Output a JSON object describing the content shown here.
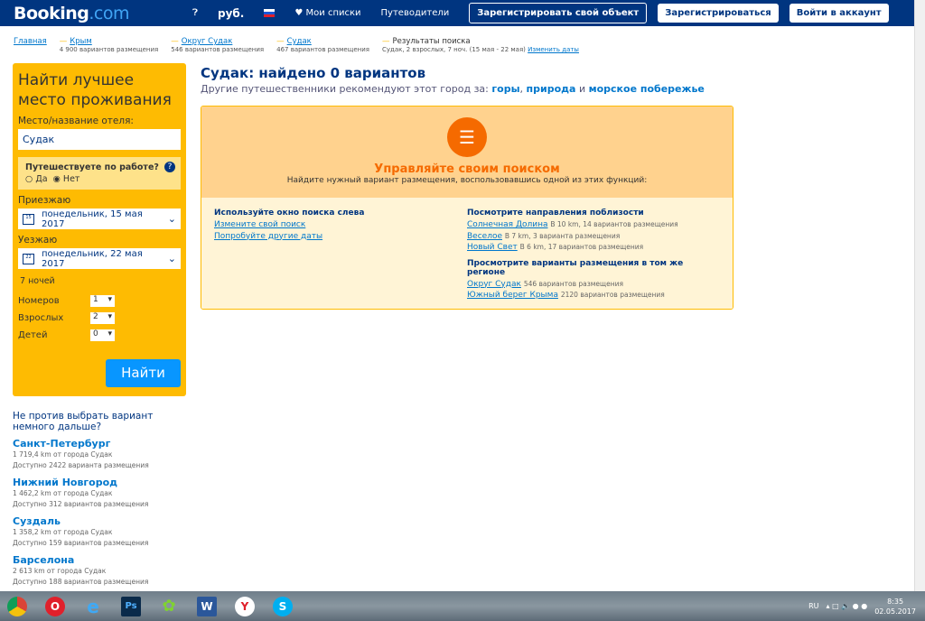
{
  "header": {
    "logo_main": "Booking",
    "logo_tld": ".com",
    "currency": "руб.",
    "my_lists": "Мои списки",
    "guides": "Путеводители",
    "register_property": "Зарегистрировать свой объект",
    "register": "Зарегистрироваться",
    "sign_in": "Войти в аккаунт"
  },
  "breadcrumbs": [
    {
      "label": "Главная",
      "sub": ""
    },
    {
      "label": "Крым",
      "sub": "4 900 вариантов размещения"
    },
    {
      "label": "Округ Судак",
      "sub": "546 вариантов размещения"
    },
    {
      "label": "Судак",
      "sub": "467 вариантов размещения"
    },
    {
      "label": "Результаты поиска",
      "sub": "Судак, 2 взрослых, 7 ноч. (15 мая - 22 мая)",
      "link": "Изменить даты"
    }
  ],
  "search": {
    "title": "Найти лучшее место проживания",
    "dest_label": "Место/название отеля:",
    "dest_value": "Судак",
    "business_q": "Путешествуете по работе?",
    "yes": "Да",
    "no": "Нет",
    "business_selected": "Нет",
    "checkin_label": "Приезжаю",
    "checkin_day": "15",
    "checkin": "понедельник, 15 мая 2017",
    "checkout_label": "Уезжаю",
    "checkout_day": "22",
    "checkout": "понедельник, 22 мая 2017",
    "nights": "7 ночей",
    "rooms_label": "Номеров",
    "rooms": "1",
    "adults_label": "Взрослых",
    "adults": "2",
    "children_label": "Детей",
    "children": "0",
    "submit": "Найти"
  },
  "alternatives": {
    "title": "Не против выбрать вариант немного дальше?",
    "items": [
      {
        "name": "Санкт-Петербург",
        "dist": "1 719,4 km от города Судак",
        "avail": "Доступно 2422 варианта размещения"
      },
      {
        "name": "Нижний Новгород",
        "dist": "1 462,2 km от города Судак",
        "avail": "Доступно 312 вариантов размещения"
      },
      {
        "name": "Суздаль",
        "dist": "1 358,2 km от города Судак",
        "avail": "Доступно 159 вариантов размещения"
      },
      {
        "name": "Барселона",
        "dist": "2 613 km от города Судак",
        "avail": "Доступно 188 вариантов размещения"
      }
    ]
  },
  "main": {
    "title": "Судак: найдено 0 вариантов",
    "rec_prefix": "Другие путешественники рекомендуют этот город за:",
    "rec1": "горы",
    "rec2": "природа",
    "rec_and": "и",
    "rec3": "морское побережье",
    "manage_title": "Управляйте своим поиском",
    "manage_sub": "Найдите нужный вариант размещения, воспользовавшись одной из этих функций:",
    "left_title": "Используйте окно поиска слева",
    "left_links": [
      "Измените свой поиск",
      "Попробуйте другие даты"
    ],
    "nearby_title": "Посмотрите направления поблизости",
    "nearby": [
      {
        "name": "Солнечная Долина",
        "info": "В 10 km, 14 вариантов размещения"
      },
      {
        "name": "Веселое",
        "info": "В 7 km, 3 варианта размещения"
      },
      {
        "name": "Новый Свет",
        "info": "В 6 km, 17 вариантов размещения"
      }
    ],
    "region_title": "Просмотрите варианты размещения в том же регионе",
    "region": [
      {
        "name": "Округ Судак",
        "info": "546 вариантов размещения"
      },
      {
        "name": "Южный берег Крыма",
        "info": "2120 вариантов размещения"
      }
    ]
  },
  "taskbar": {
    "lang": "RU",
    "time": "8:35",
    "date": "02.05.2017",
    "apps": [
      "chrome",
      "opera",
      "internet-explorer",
      "photoshop",
      "icq",
      "word",
      "yandex-browser",
      "skype"
    ]
  },
  "colors": {
    "brand": "#003580",
    "accent": "#febb02",
    "button": "#0896ff",
    "orange": "#f56a00"
  }
}
